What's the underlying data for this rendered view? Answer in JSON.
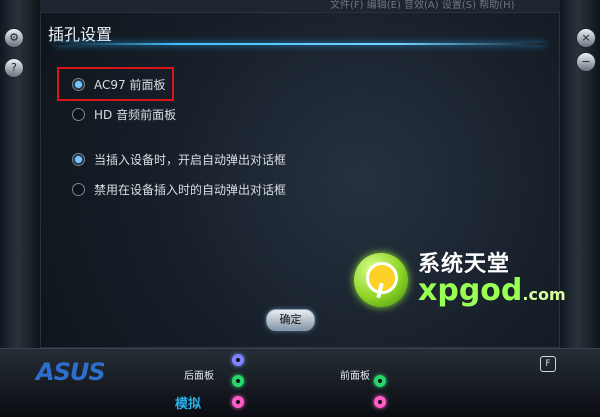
{
  "topbar": {
    "text": "文件(F)   编辑(E)   音效(A)   设置(S)   帮助(H)"
  },
  "dialog": {
    "title": "插孔设置",
    "front_panel_options": [
      {
        "label": "AC97 前面板",
        "checked": true
      },
      {
        "label": "HD 音频前面板",
        "checked": false
      }
    ],
    "popup_options": [
      {
        "label": "当插入设备时，开启自动弹出对话框",
        "checked": true
      },
      {
        "label": "禁用在设备插入时的自动弹出对话框",
        "checked": false
      }
    ],
    "ok_button": "确定"
  },
  "footer": {
    "brand": "ASUS",
    "rear_panel_label": "后面板",
    "front_panel_label": "前面板",
    "analog_label": "模拟",
    "jack_colors": {
      "blue": "#7d84ff",
      "green": "#2ad66c",
      "pink": "#ff5cc8"
    }
  },
  "watermark": {
    "brand_cn": "系统天堂",
    "brand_url": "xpgod",
    "domain_suffix": ".com"
  },
  "icons": {
    "left": [
      "settings-icon",
      "help-icon"
    ],
    "right": [
      "close-icon",
      "minimize-icon"
    ]
  }
}
